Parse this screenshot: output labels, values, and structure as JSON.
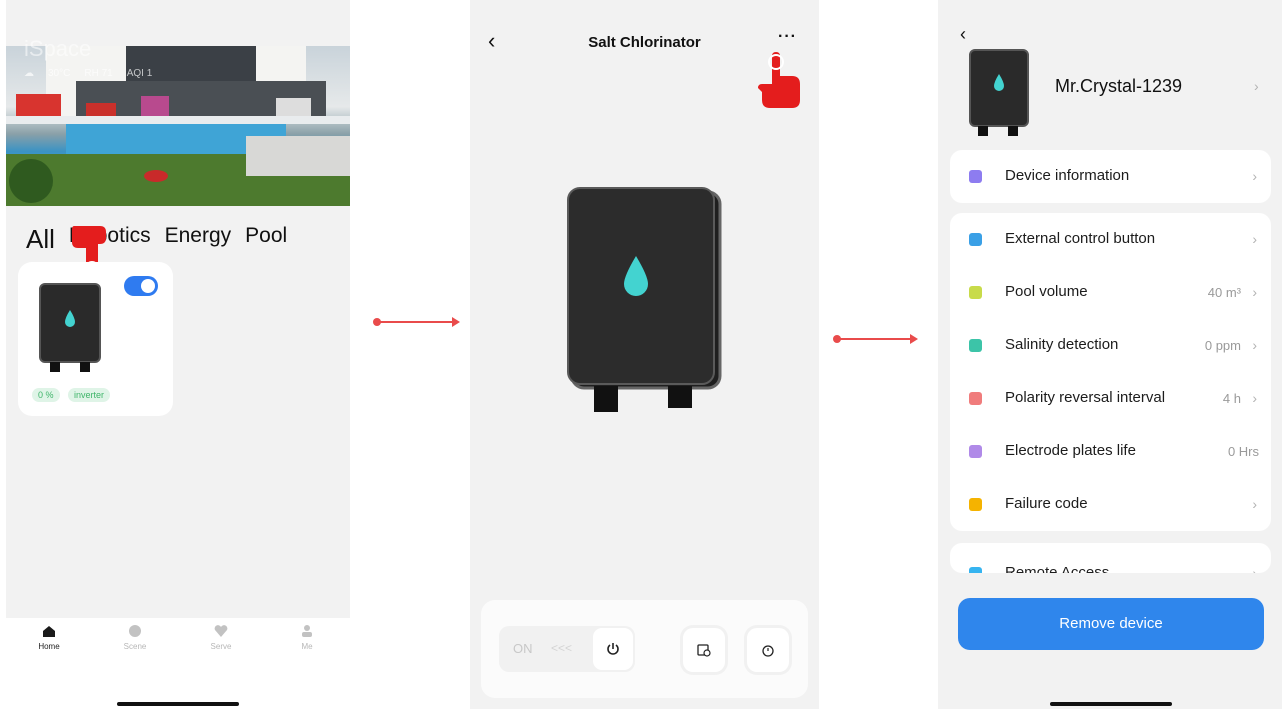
{
  "panel1": {
    "hero_overlay": {
      "title": "iSpace",
      "weather": "30°C",
      "humidity": "RH 71",
      "aqi": "AQI 1"
    },
    "tabs": [
      "All",
      "Robotics",
      "Energy",
      "Pool"
    ],
    "device_card": {
      "toggle_on": true,
      "chips": [
        "0 %",
        "inverter"
      ]
    },
    "nav": [
      "Home",
      "Scene",
      "Serve",
      "Me"
    ]
  },
  "panel2": {
    "title": "Salt Chlorinator",
    "back_glyph": "‹",
    "more_glyph": "···",
    "controls": {
      "on_label": "ON",
      "arrows": "<<<"
    }
  },
  "panel3": {
    "back_glyph": "‹",
    "device_name": "Mr.Crystal-1239",
    "group1": [
      {
        "label": "Device information",
        "value": "",
        "chevron": true,
        "icon": "info-icon",
        "color": "#8d7cf0"
      }
    ],
    "group2": [
      {
        "label": "External control button",
        "value": "",
        "chevron": true,
        "icon": "control-icon",
        "color": "#3aa0e6"
      },
      {
        "label": "Pool volume",
        "value": "40 m³",
        "chevron": true,
        "icon": "volume-icon",
        "color": "#c8db4a"
      },
      {
        "label": "Salinity detection",
        "value": "0 ppm",
        "chevron": true,
        "icon": "flask-icon",
        "color": "#3cc4a8"
      },
      {
        "label": "Polarity reversal interval",
        "value": "4 h",
        "chevron": true,
        "icon": "clock-icon",
        "color": "#f07c7c"
      },
      {
        "label": "Electrode plates life",
        "value": "0 Hrs",
        "chevron": false,
        "icon": "diamond-icon",
        "color": "#b08ae8"
      },
      {
        "label": "Failure code",
        "value": "",
        "chevron": true,
        "icon": "warning-icon",
        "color": "#f5b300"
      }
    ],
    "group3": [
      {
        "label": "Remote Access",
        "value": "",
        "chevron": true,
        "icon": "remote-icon",
        "color": "#36b4f0"
      }
    ],
    "remove_label": "Remove device"
  },
  "colors": {
    "accent": "#2f86ec",
    "arrow": "#e94b4b",
    "hand": "#e41d1d",
    "drop": "#43d3d0"
  }
}
